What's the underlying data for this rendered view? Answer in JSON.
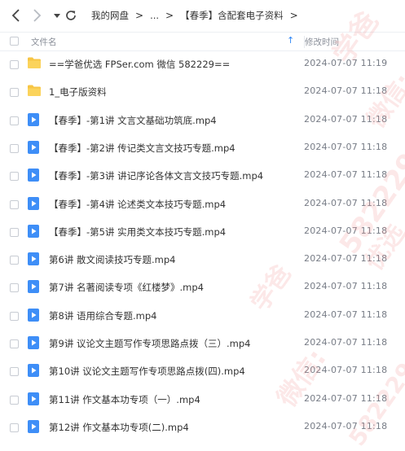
{
  "toolbar": {
    "back_icon": "chevron-left-icon",
    "forward_icon": "chevron-right-icon",
    "history_icon": "caret-down-icon",
    "refresh_icon": "refresh-icon"
  },
  "breadcrumb": {
    "root": "我的网盘",
    "ellipsis": "...",
    "current": "【春季】含配套电子资料",
    "separator": ">"
  },
  "table": {
    "col_name": "文件名",
    "col_time": "修改时间",
    "sort_icon": "arrow-up-icon"
  },
  "files": [
    {
      "name": "==学爸优选 FPSer.com 微信 582229==",
      "time": "2024-07-07 11:19",
      "type": "folder"
    },
    {
      "name": "1_电子版资料",
      "time": "2024-07-07 11:18",
      "type": "folder"
    },
    {
      "name": "【春季】-第1讲 文言文基础功筑底.mp4",
      "time": "2024-07-07 11:18",
      "type": "video"
    },
    {
      "name": "【春季】-第2讲 传记类文言文技巧专题.mp4",
      "time": "2024-07-07 11:18",
      "type": "video"
    },
    {
      "name": "【春季】-第3讲 讲记序论各体文言文技巧专题.mp4",
      "time": "2024-07-07 11:18",
      "type": "video"
    },
    {
      "name": "【春季】-第4讲 论述类文本技巧专题.mp4",
      "time": "2024-07-07 11:18",
      "type": "video"
    },
    {
      "name": "【春季】-第5讲 实用类文本技巧专题.mp4",
      "time": "2024-07-07 11:18",
      "type": "video"
    },
    {
      "name": "第6讲 散文阅读技巧专题.mp4",
      "time": "2024-07-07 11:18",
      "type": "video"
    },
    {
      "name": "第7讲 名著阅读专项《红楼梦》.mp4",
      "time": "2024-07-07 11:18",
      "type": "video"
    },
    {
      "name": "第8讲 语用综合专题.mp4",
      "time": "2024-07-07 11:18",
      "type": "video"
    },
    {
      "name": "第9讲 议论文主题写作专项思路点拨（三）.mp4",
      "time": "2024-07-07 11:18",
      "type": "video"
    },
    {
      "name": "第10讲 议论文主题写作专项思路点拨(四).mp4",
      "time": "2024-07-07 11:18",
      "type": "video"
    },
    {
      "name": "第11讲 作文基本功专项（一）.mp4",
      "time": "2024-07-07 11:18",
      "type": "video"
    },
    {
      "name": "第12讲 作文基本功专项(二).mp4",
      "time": "2024-07-07 11:18",
      "type": "video"
    }
  ],
  "watermark": {
    "texts": [
      "学爸",
      "微信:",
      "582229",
      "优选",
      "学爸",
      "微信:",
      "582229"
    ],
    "color": "#f09696"
  },
  "colors": {
    "accent": "#2e86f5",
    "folder": "#f7c544",
    "video": "#3e8ef7"
  }
}
